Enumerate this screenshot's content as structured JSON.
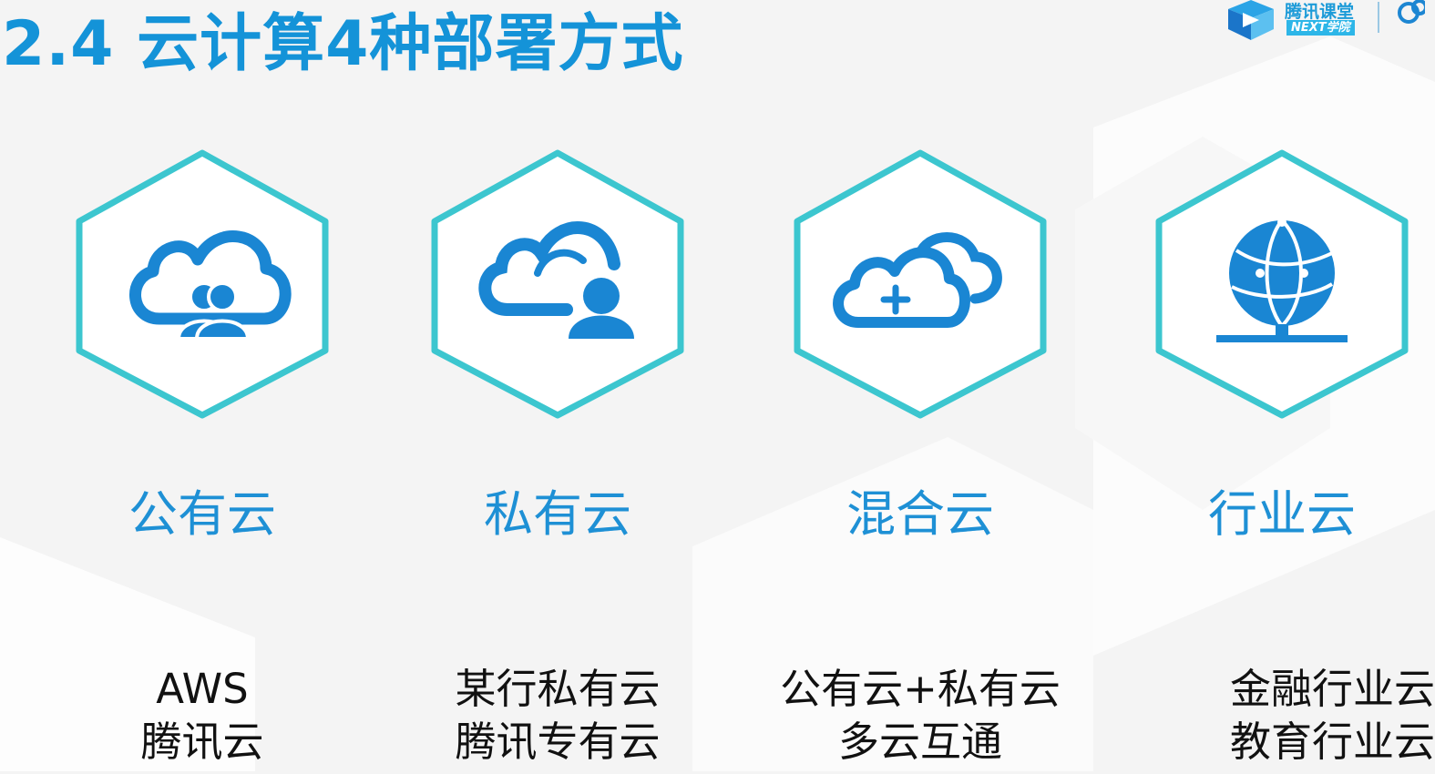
{
  "slide": {
    "title": "2.4 云计算4种部署方式"
  },
  "logo": {
    "name": "腾讯课堂",
    "sub": "NEXT学院"
  },
  "colors": {
    "accent": "#1e90d5",
    "hex_border": "#3cc6cf",
    "icon": "#1a86d3"
  },
  "cards": [
    {
      "icon": "cloud-users-icon",
      "name": "公有云",
      "examples": [
        "AWS",
        "腾讯云"
      ]
    },
    {
      "icon": "cloud-user-icon",
      "name": "私有云",
      "examples": [
        "某行私有云",
        "腾讯专有云"
      ]
    },
    {
      "icon": "cloud-plus-icon",
      "name": "混合云",
      "examples": [
        "公有云+私有云",
        "多云互通"
      ]
    },
    {
      "icon": "network-globe-icon",
      "name": "行业云",
      "examples": [
        "金融行业云",
        "教育行业云"
      ]
    }
  ]
}
